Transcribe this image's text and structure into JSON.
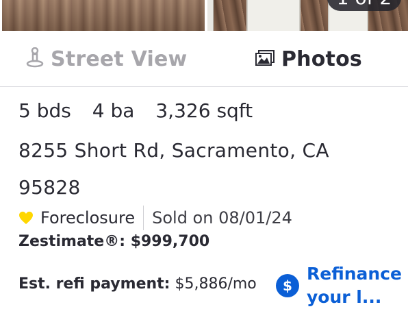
{
  "photos": {
    "counter_text": "1 of 2"
  },
  "view_tabs": {
    "street_view_label": "Street View",
    "photos_label": "Photos",
    "street_view_icon": "street-view-person-icon",
    "photos_icon": "photo-gallery-icon"
  },
  "facts": {
    "beds_value": "5",
    "beds_label": "bds",
    "baths_value": "4",
    "baths_label": "ba",
    "sqft_value": "3,326",
    "sqft_label": "sqft"
  },
  "address": {
    "line": "8255 Short Rd, Sacramento, CA 95828"
  },
  "status": {
    "type": "Foreclosure",
    "sold_text": "Sold on 08/01/24",
    "heart_color": "#ffd700"
  },
  "zestimate": {
    "text": "Zestimate®: $999,700"
  },
  "refi": {
    "label": "Est. refi payment:",
    "value": "$5,886/mo",
    "cta_text": "Refinance your l...",
    "badge_symbol": "$"
  }
}
